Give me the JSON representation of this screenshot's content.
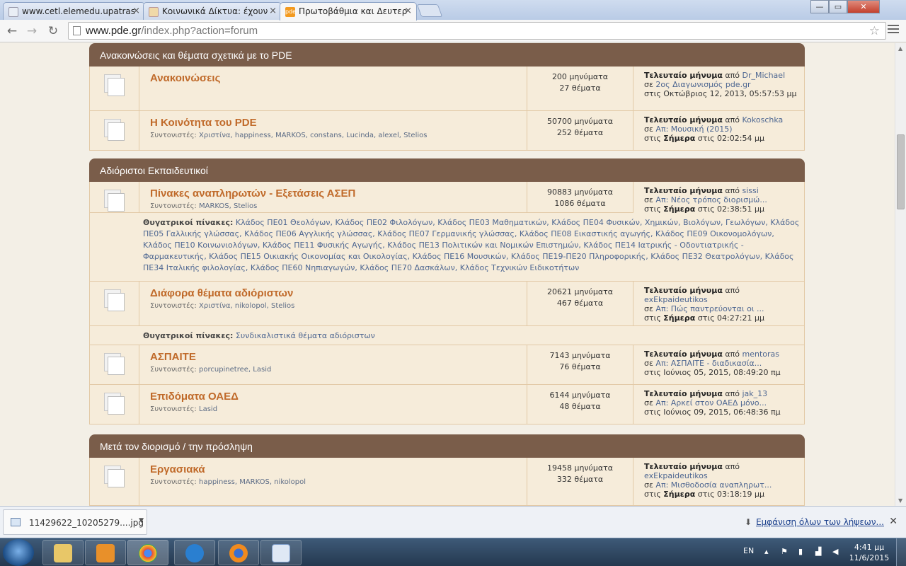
{
  "browser": {
    "tabs": [
      {
        "title": "www.cetl.elemedu.upatras"
      },
      {
        "title": "Κοινωνικά Δίκτυα: έχουν"
      },
      {
        "title": "Πρωτοβάθμια και Δευτερ"
      }
    ],
    "url_host": "www.pde.gr",
    "url_path": "/index.php?action=forum",
    "window_controls": {
      "minimize": "—",
      "maximize": "▭",
      "close": "✕"
    },
    "back_icon": "←",
    "forward_icon": "→",
    "reload_icon": "↻",
    "star_icon": "☆"
  },
  "categories": [
    {
      "title": "Ανακοινώσεις και θέματα σχετικά με το PDE",
      "boards": [
        {
          "name": "Ανακοινώσεις",
          "moderators_label": "",
          "moderators": "",
          "posts": "200 μηνύματα",
          "topics": "27 θέματα",
          "last_label": "Τελευταίο μήνυμα",
          "by": "από",
          "user": "Dr_Michael",
          "in": "σε",
          "topic": "2ος Διαγωνισμός pde.gr",
          "when": "στις Οκτώβριος 12, 2013, 05:57:53 μμ",
          "today": ""
        },
        {
          "name": "Η Κοινότητα του PDE",
          "moderators_label": "Συντονιστές:",
          "moderators": "Χριστίνα, happiness, MARKOS, constans, Lucinda, alexel, Stelios",
          "posts": "50700 μηνύματα",
          "topics": "252 θέματα",
          "last_label": "Τελευταίο μήνυμα",
          "by": "από",
          "user": "Kokoschka",
          "in": "σε",
          "topic": "Απ: Μουσική (2015)",
          "when_pre": "στις",
          "today": "Σήμερα",
          "when": "στις 02:02:54 μμ"
        }
      ]
    },
    {
      "title": "Αδιόριστοι Εκπαιδευτικοί",
      "boards": [
        {
          "name": "Πίνακες αναπληρωτών - Εξετάσεις ΑΣΕΠ",
          "moderators_label": "Συντονιστές:",
          "moderators": "MARKOS, Stelios",
          "posts": "90883 μηνύματα",
          "topics": "1086 θέματα",
          "last_label": "Τελευταίο μήνυμα",
          "by": "από",
          "user": "sissi",
          "in": "σε",
          "topic": "Απ: Νέος τρόπος διορισμώ...",
          "when_pre": "στις",
          "today": "Σήμερα",
          "when": "στις 02:38:51 μμ",
          "child_label": "Θυγατρικοί πίνακες:",
          "children": "Κλάδος ΠΕ01 Θεολόγων, Κλάδος ΠΕ02 Φιλολόγων, Κλάδος ΠΕ03 Μαθηματικών, Κλάδος ΠΕ04 Φυσικών, Χημικών, Βιολόγων, Γεωλόγων, Κλάδος ΠΕ05 Γαλλικής γλώσσας, Κλάδος ΠΕ06 Αγγλικής γλώσσας, Κλάδος ΠΕ07 Γερμανικής γλώσσας, Κλάδος ΠΕ08 Εικαστικής αγωγής, Κλάδος ΠΕ09 Οικονομολόγων, Κλάδος ΠΕ10 Κοινωνιολόγων, Κλάδος ΠΕ11 Φυσικής Αγωγής, Κλάδος ΠΕ13 Πολιτικών και Νομικών Επιστημών, Κλάδος ΠΕ14 Ιατρικής - Οδοντιατρικής - Φαρμακευτικής, Κλάδος ΠΕ15 Οικιακής Οικονομίας και Οικολογίας, Κλάδος ΠΕ16 Μουσικών, Κλάδος ΠΕ19-ΠΕ20 Πληροφορικής, Κλάδος ΠΕ32 Θεατρολόγων, Κλάδος ΠΕ34 Ιταλικής φιλολογίας, Κλάδος ΠΕ60 Νηπιαγωγών, Κλάδος ΠΕ70 Δασκάλων, Κλάδος Τεχνικών Ειδικοτήτων"
        },
        {
          "name": "Διάφορα θέματα αδιόριστων",
          "moderators_label": "Συντονιστές:",
          "moderators": "Χριστίνα, nikolopol, Stelios",
          "posts": "20621 μηνύματα",
          "topics": "467 θέματα",
          "last_label": "Τελευταίο μήνυμα",
          "by": "από",
          "user": "exEkpaideutikos",
          "in": "σε",
          "topic": "Απ: Πώς παντρεύονται οι ...",
          "when_pre": "στις",
          "today": "Σήμερα",
          "when": "στις 04:27:21 μμ",
          "child_label": "Θυγατρικοί πίνακες:",
          "children": "Συνδικαλιστικά θέματα αδιόριστων"
        },
        {
          "name": "ΑΣΠΑΙΤΕ",
          "moderators_label": "Συντονιστές:",
          "moderators": "porcupinetree, Lasid",
          "posts": "7143 μηνύματα",
          "topics": "76 θέματα",
          "last_label": "Τελευταίο μήνυμα",
          "by": "από",
          "user": "mentoras",
          "in": "σε",
          "topic": "Απ: ΑΣΠΑΙΤΕ - διαδικασία...",
          "when": "στις Ιούνιος 05, 2015, 08:49:20 πμ"
        },
        {
          "name": "Επιδόματα ΟΑΕΔ",
          "moderators_label": "Συντονιστές:",
          "moderators": "Lasid",
          "posts": "6144 μηνύματα",
          "topics": "48 θέματα",
          "last_label": "Τελευταίο μήνυμα",
          "by": "από",
          "user": "jak_13",
          "in": "σε",
          "topic": "Απ: Αρκεί στον ΟΑΕΔ μόνο...",
          "when": "στις Ιούνιος 09, 2015, 06:48:36 πμ"
        }
      ]
    },
    {
      "title": "Μετά τον διορισμό / την πρόσληψη",
      "boards": [
        {
          "name": "Εργασιακά",
          "moderators_label": "Συντονιστές:",
          "moderators": "happiness, MARKOS, nikolopol",
          "posts": "19458 μηνύματα",
          "topics": "332 θέματα",
          "last_label": "Τελευταίο μήνυμα",
          "by": "από",
          "user": "exEkpaideutikos",
          "in": "σε",
          "topic": "Απ: Μισθοδοσία αναπληρωτ...",
          "when_pre": "στις",
          "today": "Σήμερα",
          "when": "στις 03:18:19 μμ"
        }
      ]
    }
  ],
  "downloads": {
    "file": "11429622_10205279....jpg",
    "show_all": "Εμφάνιση όλων των λήψεων...",
    "close": "✕"
  },
  "taskbar": {
    "lang": "EN",
    "time": "4:41 μμ",
    "date": "11/6/2015"
  },
  "colors": {
    "category_header": "#7a5d4a",
    "board_title": "#c06a2a",
    "row_bg": "#f6ecda",
    "link": "#4d6691"
  }
}
